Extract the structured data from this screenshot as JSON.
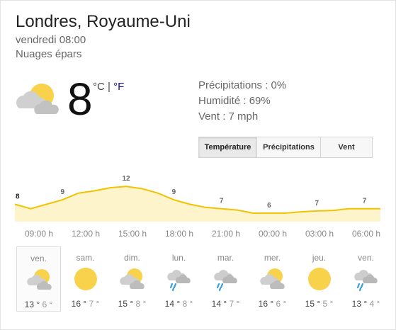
{
  "location": "Londres, Royaume-Uni",
  "datetime": "vendredi 08:00",
  "condition": "Nuages épars",
  "current": {
    "temp": "8",
    "unit_c": "°C",
    "sep": "|",
    "unit_f": "°F",
    "icon": "partly-cloudy-icon"
  },
  "stats": [
    {
      "label": "Précipitations : 0%"
    },
    {
      "label": "Humidité : 69%"
    },
    {
      "label": "Vent : 7 mph"
    }
  ],
  "tabs": [
    {
      "label": "Température",
      "active": true
    },
    {
      "label": "Précipitations",
      "active": false
    },
    {
      "label": "Vent",
      "active": false
    }
  ],
  "colors": {
    "line": "#f2c300",
    "fill": "#fdf4cc",
    "sun": "#f8d24a",
    "cloud": "#c8c8c8",
    "rain": "#3a9fd8"
  },
  "chart_data": {
    "type": "area",
    "x": [
      "08:00",
      "09:00",
      "10:00",
      "11:00",
      "12:00",
      "13:00",
      "14:00",
      "15:00",
      "16:00",
      "17:00",
      "18:00",
      "19:00",
      "20:00",
      "21:00",
      "22:00",
      "23:00",
      "00:00",
      "01:00",
      "02:00",
      "03:00",
      "04:00",
      "05:00",
      "06:00",
      "07:00"
    ],
    "values": [
      8,
      7,
      8,
      9,
      10.5,
      11,
      11.7,
      12,
      11.5,
      10.5,
      9,
      8,
      7.3,
      7,
      6.7,
      6,
      6,
      6,
      6.3,
      6.5,
      6.6,
      7,
      7,
      7
    ],
    "labels": [
      {
        "index": 0,
        "text": "8"
      },
      {
        "index": 3,
        "text": "9"
      },
      {
        "index": 7,
        "text": "12"
      },
      {
        "index": 10,
        "text": "9"
      },
      {
        "index": 13,
        "text": "7"
      },
      {
        "index": 16,
        "text": "6"
      },
      {
        "index": 19,
        "text": "7"
      },
      {
        "index": 22,
        "text": "7"
      }
    ],
    "ticks": [
      "09:00 h",
      "12:00 h",
      "15:00 h",
      "18:00 h",
      "21:00 h",
      "00:00 h",
      "03:00 h",
      "06:00 h"
    ]
  },
  "forecast": [
    {
      "day": "ven.",
      "hi": "13 °",
      "lo": "6 °",
      "icon": "partly-cloudy-icon",
      "selected": true
    },
    {
      "day": "sam.",
      "hi": "16 °",
      "lo": "7 °",
      "icon": "sunny-icon",
      "selected": false
    },
    {
      "day": "dim.",
      "hi": "15 °",
      "lo": "8 °",
      "icon": "partly-cloudy-icon",
      "selected": false
    },
    {
      "day": "lun.",
      "hi": "14 °",
      "lo": "8 °",
      "icon": "showers-icon",
      "selected": false
    },
    {
      "day": "mar.",
      "hi": "14 °",
      "lo": "7 °",
      "icon": "showers-icon",
      "selected": false
    },
    {
      "day": "mer.",
      "hi": "16 °",
      "lo": "6 °",
      "icon": "partly-cloudy-icon",
      "selected": false
    },
    {
      "day": "jeu.",
      "hi": "15 °",
      "lo": "5 °",
      "icon": "sunny-icon",
      "selected": false
    },
    {
      "day": "ven.",
      "hi": "13 °",
      "lo": "4 °",
      "icon": "showers-icon",
      "selected": false
    }
  ]
}
